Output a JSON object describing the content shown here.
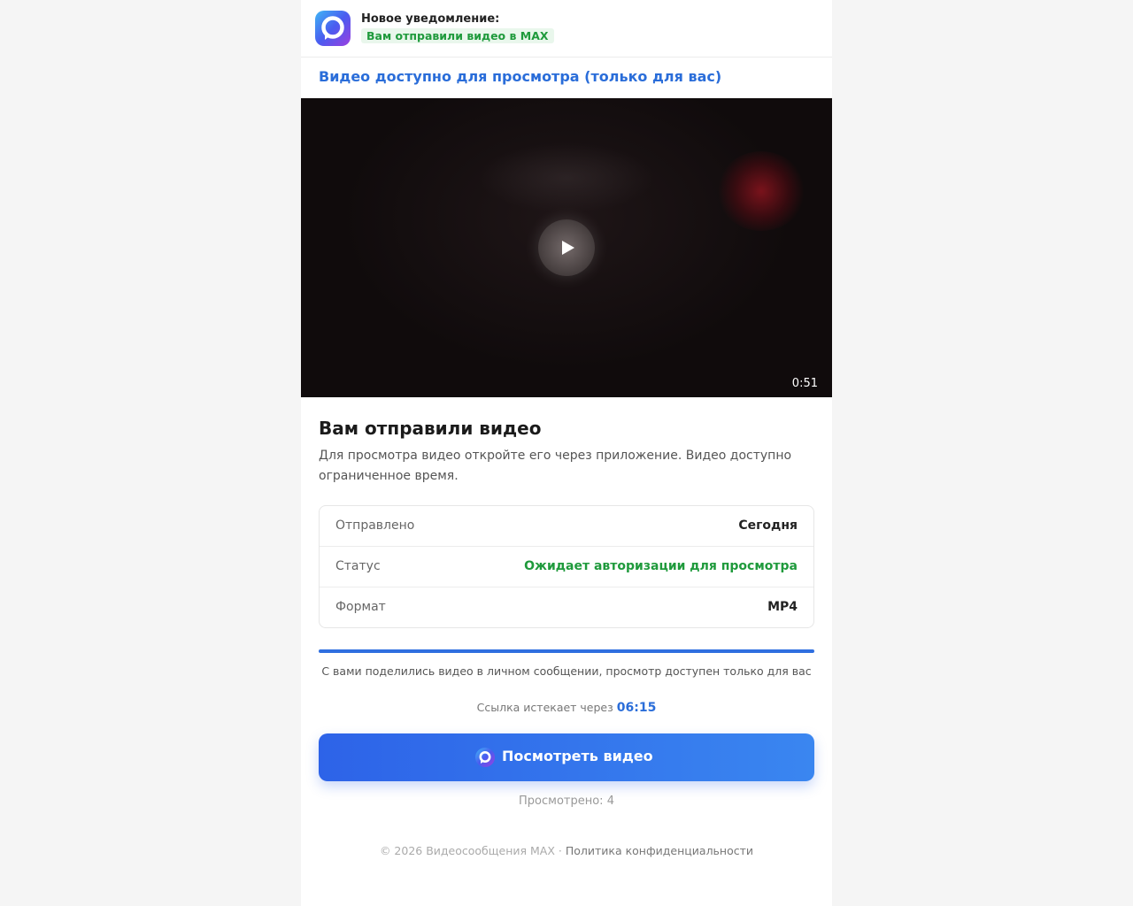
{
  "notification": {
    "title": "Новое уведомление:",
    "badge": "Вам отправили видео в MAX"
  },
  "video": {
    "caption": "Видео доступно для просмотра (только для вас)",
    "duration": "0:51"
  },
  "message": {
    "heading": "Вам отправили видео",
    "description": "Для просмотра видео откройте его через приложение. Видео доступно ограниченное время."
  },
  "info": [
    {
      "label": "Отправлено",
      "value": "Сегодня"
    },
    {
      "label": "Статус",
      "value": "Ожидает авторизации для просмотра"
    },
    {
      "label": "Формат",
      "value": "MP4"
    }
  ],
  "progress": {
    "fraction": 1.0
  },
  "share_note": "С вами поделились видео в личном сообщении, просмотр доступен только для вас",
  "expiry": {
    "label": "Ссылка истекает через",
    "timer": "06:15"
  },
  "watch_button": {
    "label": "Посмотреть видео"
  },
  "views": "Просмотрено: 4",
  "footer": {
    "copyright": "© 2026 Видеосообщения MAX · ",
    "privacy_link": "Политика конфиденциальности"
  },
  "colors": {
    "accent": "#2a6dd9",
    "button_start": "#2d63e8",
    "button_end": "#3a86f0",
    "status_green": "#1f9a3c"
  },
  "icons": {
    "app_logo": "max-logo-icon",
    "play": "play-icon"
  }
}
